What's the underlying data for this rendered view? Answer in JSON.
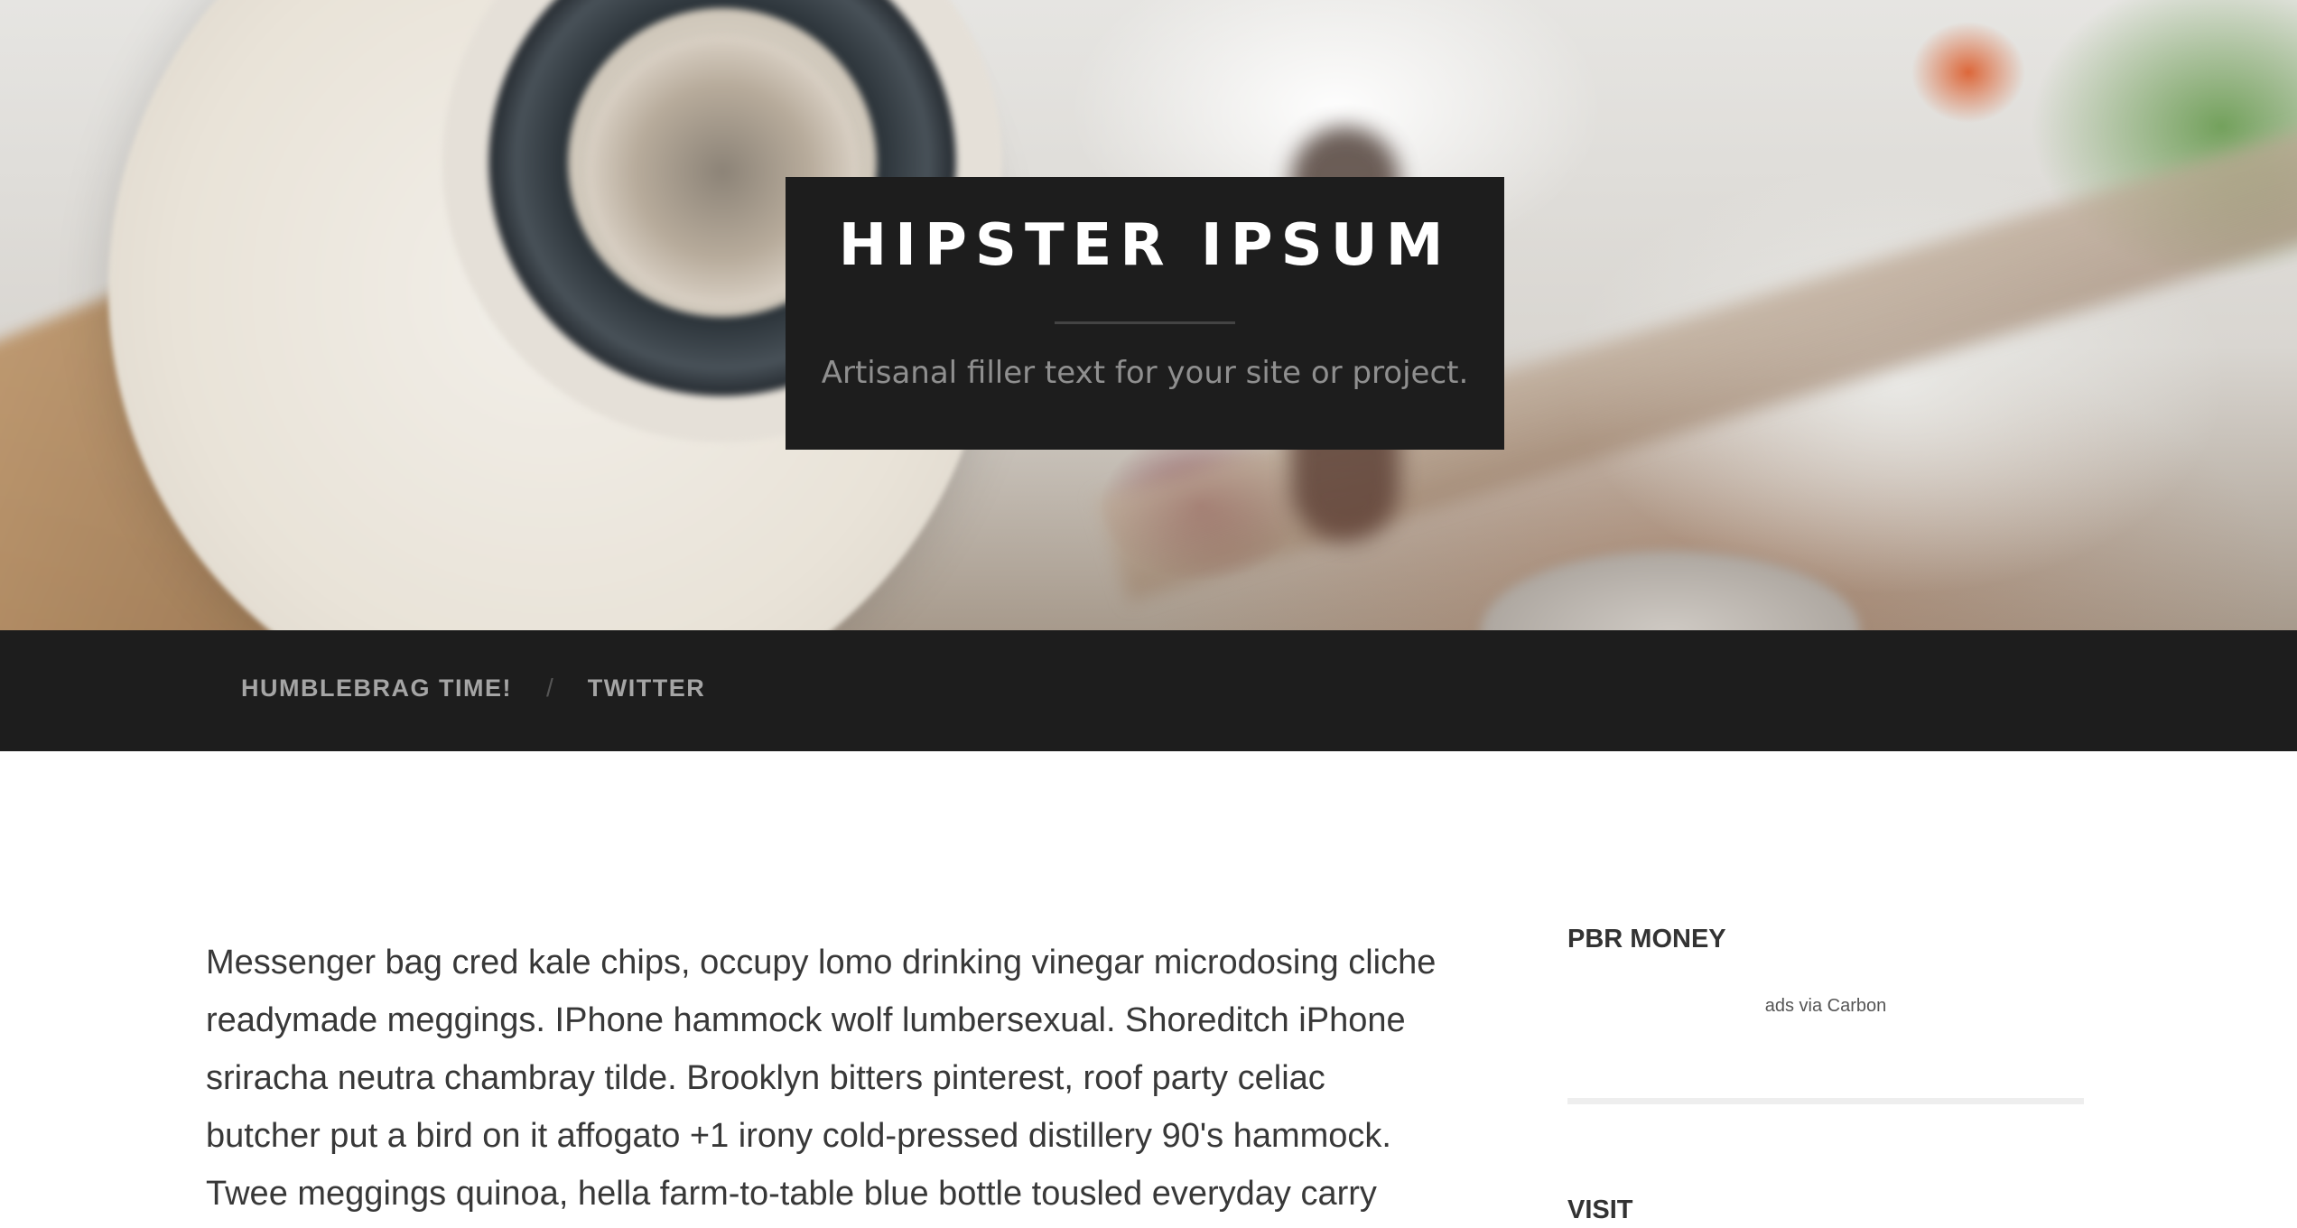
{
  "header": {
    "site_title": "HIPSTER IPSUM",
    "tagline": "Artisanal filler text for your site or project."
  },
  "nav": {
    "items": [
      {
        "label": "HUMBLEBRAG TIME!"
      },
      {
        "label": "TWITTER"
      }
    ],
    "separator": "/"
  },
  "main": {
    "post_text": "Messenger bag cred kale chips, occupy lomo drinking vinegar microdosing cliche readymade meggings. IPhone hammock wolf lumbersexual. Shoreditch iPhone sriracha neutra chambray tilde. Brooklyn bitters pinterest, roof party celiac butcher put a bird on it affogato +1 irony cold-pressed distillery 90's hammock. Twee meggings quinoa, hella farm-to-table blue bottle tousled everyday carry"
  },
  "sidebar": {
    "widgets": [
      {
        "title": "PBR MONEY",
        "ad_text": "ads via Carbon"
      },
      {
        "title": "VISIT"
      }
    ]
  },
  "colors": {
    "dark_bar": "#1d1d1d",
    "nav_text": "#a5a5a5",
    "body_text": "#383838",
    "background": "#ffffff"
  }
}
